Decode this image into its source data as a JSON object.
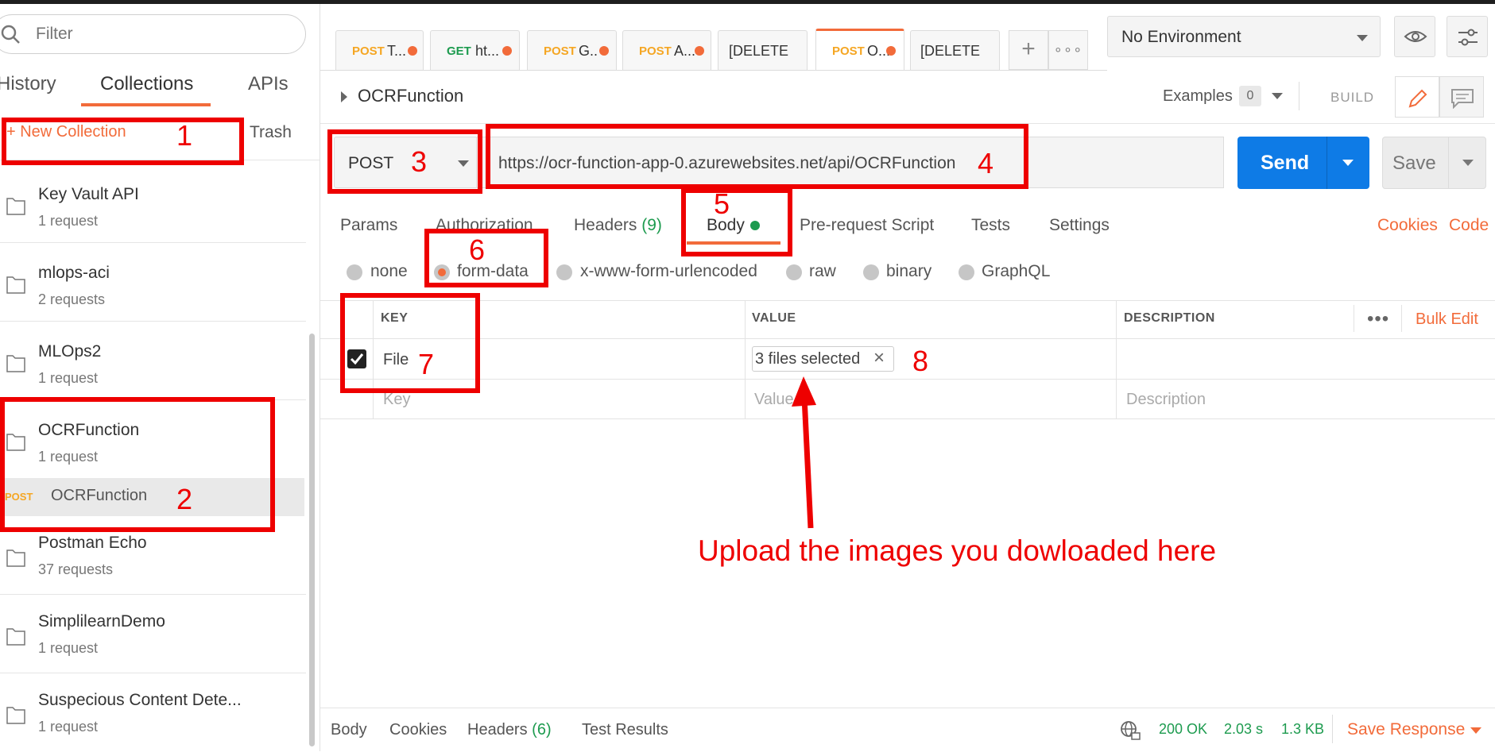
{
  "sidebar": {
    "filter_placeholder": "Filter",
    "tabs": [
      "History",
      "Collections",
      "APIs"
    ],
    "new_collection": "+ New Collection",
    "trash": "Trash",
    "collections": [
      {
        "name": "Key Vault API",
        "count": "1 request"
      },
      {
        "name": "mlops-aci",
        "count": "2 requests"
      },
      {
        "name": "MLOps2",
        "count": "1 request"
      },
      {
        "name": "OCRFunction",
        "count": "1 request"
      },
      {
        "name": "Postman Echo",
        "count": "37 requests"
      },
      {
        "name": "SimplilearnDemo",
        "count": "1 request"
      },
      {
        "name": "Suspecious Content Dete...",
        "count": "1 request"
      }
    ],
    "open_request": {
      "method": "POST",
      "name": "OCRFunction"
    }
  },
  "request_tabs": [
    {
      "method": "POST",
      "title": "T..."
    },
    {
      "method": "GET",
      "title": "ht..."
    },
    {
      "method": "POST",
      "title": "G.."
    },
    {
      "method": "POST",
      "title": "A..."
    },
    {
      "method": "",
      "title": "[DELETE"
    },
    {
      "method": "POST",
      "title": "O..."
    },
    {
      "method": "",
      "title": "[DELETE"
    }
  ],
  "environment": {
    "selected": "No Environment"
  },
  "request": {
    "title": "OCRFunction",
    "examples_label": "Examples",
    "examples_count": "0",
    "build_label": "BUILD",
    "method": "POST",
    "url": "https://ocr-function-app-0.azurewebsites.net/api/OCRFunction",
    "send": "Send",
    "save": "Save"
  },
  "subtabs": {
    "params": "Params",
    "authorization": "Authorization",
    "headers": "Headers",
    "headers_count": "(9)",
    "body": "Body",
    "prerequest": "Pre-request Script",
    "tests": "Tests",
    "settings": "Settings",
    "cookies": "Cookies",
    "code": "Code"
  },
  "body_types": [
    "none",
    "form-data",
    "x-www-form-urlencoded",
    "raw",
    "binary",
    "GraphQL"
  ],
  "table": {
    "headers": [
      "KEY",
      "VALUE",
      "DESCRIPTION"
    ],
    "bulk_edit": "Bulk Edit",
    "row": {
      "key": "File",
      "value": "3 files selected"
    },
    "placeholders": {
      "key": "Key",
      "value": "Value",
      "description": "Description"
    }
  },
  "response": {
    "tabs": {
      "body": "Body",
      "cookies": "Cookies",
      "headers": "Headers",
      "headers_count": "(6)",
      "test_results": "Test Results"
    },
    "status": "200 OK",
    "time": "2.03 s",
    "size": "1.3 KB",
    "save_response": "Save Response"
  },
  "annotations": {
    "numbers": [
      "1",
      "2",
      "3",
      "4",
      "5",
      "6",
      "7",
      "8"
    ],
    "note": "Upload the images you dowloaded here"
  }
}
